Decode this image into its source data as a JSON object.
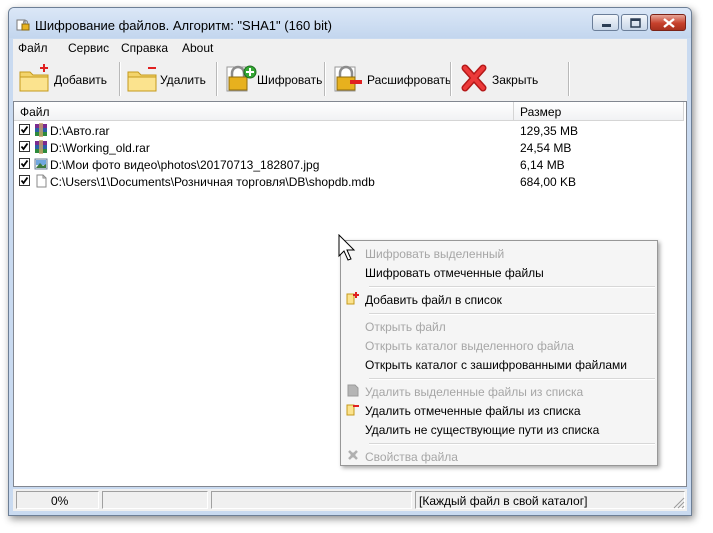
{
  "window": {
    "title": "Шифрование файлов. Алгоритм: \"SHA1\" (160 bit)"
  },
  "menu": [
    "Файл",
    "Сервис",
    "Справка",
    "About"
  ],
  "toolbar": {
    "add": "Добавить",
    "remove": "Удалить",
    "encrypt": "Шифровать",
    "decrypt": "Расшифровать",
    "close": "Закрыть"
  },
  "list": {
    "columns": {
      "file": "Файл",
      "size": "Размер"
    },
    "rows": [
      {
        "name": "D:\\Авто.rar",
        "size": "129,35 MB",
        "checked": true,
        "icon": "rar-archive-icon"
      },
      {
        "name": "D:\\Working_old.rar",
        "size": "24,54 MB",
        "checked": true,
        "icon": "rar-archive-icon"
      },
      {
        "name": "D:\\Мои фото видео\\photos\\20170713_182807.jpg",
        "size": "6,14 MB",
        "checked": true,
        "icon": "image-file-icon"
      },
      {
        "name": "C:\\Users\\1\\Documents\\Розничная торговля\\DB\\shopdb.mdb",
        "size": "684,00 KB",
        "checked": true,
        "icon": "blank-file-icon"
      }
    ]
  },
  "context_menu": {
    "encrypt_selected": "Шифровать выделенный",
    "encrypt_checked": "Шифровать отмеченные файлы",
    "add_file": "Добавить файл в список",
    "open_file": "Открыть файл",
    "open_folder_selected": "Открыть каталог выделенного файла",
    "open_folder_encrypted": "Открыть каталог с зашифрованными файлами",
    "remove_selected": "Удалить выделенные файлы из списка",
    "remove_checked": "Удалить отмеченные файлы из списка",
    "remove_missing": "Удалить не существующие пути из списка",
    "file_properties": "Свойства файла"
  },
  "status": {
    "progress": "0%",
    "mode": "[Каждый файл в свой каталог]"
  }
}
